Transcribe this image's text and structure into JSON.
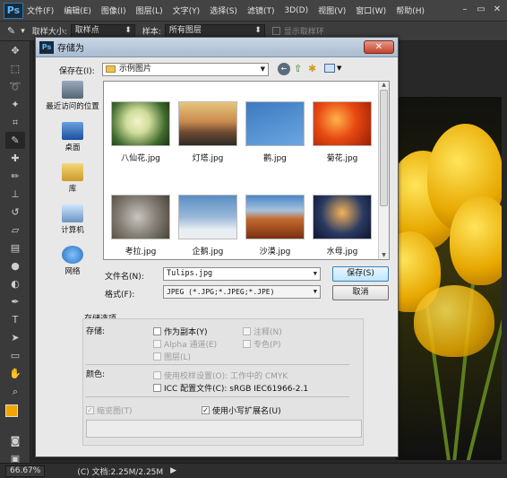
{
  "app": {
    "logo": "Ps",
    "menu": [
      "文件(F)",
      "编辑(E)",
      "图像(I)",
      "图层(L)",
      "文字(Y)",
      "选择(S)",
      "滤镜(T)",
      "3D(D)",
      "视图(V)",
      "窗口(W)",
      "帮助(H)"
    ]
  },
  "options": {
    "sample_size_label": "取样大小:",
    "sample_size_value": "取样点",
    "sample_label": "样本:",
    "sample_value": "所有图层",
    "show_ring_label": "显示取样环"
  },
  "status": {
    "zoom": "66.67%",
    "doc": "(C) 文档:2.25M/2.25M"
  },
  "dialog": {
    "title": "存储为",
    "save_in_label": "保存在(I):",
    "save_in_value": "示例图片",
    "places": [
      "最近访问的位置",
      "桌面",
      "库",
      "计算机",
      "网络"
    ],
    "files": [
      {
        "name": "八仙花.jpg"
      },
      {
        "name": "灯塔.jpg"
      },
      {
        "name": "鹳.jpg"
      },
      {
        "name": "菊花.jpg"
      },
      {
        "name": "考拉.jpg"
      },
      {
        "name": "企鹅.jpg"
      },
      {
        "name": "沙漠.jpg"
      },
      {
        "name": "水母.jpg"
      }
    ],
    "filename_label": "文件名(N):",
    "filename_value": "Tulips.jpg",
    "format_label": "格式(F):",
    "format_value": "JPEG (*.JPG;*.JPEG;*.JPE)",
    "save_button": "保存(S)",
    "cancel_button": "取消",
    "save_options_title": "存储选项",
    "save_label": "存储:",
    "as_copy": "作为副本(Y)",
    "notes": "注释(N)",
    "alpha": "Alpha 通道(E)",
    "spot": "专色(P)",
    "layers": "图层(L)",
    "color_label": "颜色:",
    "use_proof": "使用校样设置(O): 工作中的 CMYK",
    "icc": "ICC 配置文件(C): sRGB IEC61966-2.1",
    "thumbnail": "缩览图(T)",
    "lowercase_ext": "使用小写扩展名(U)"
  }
}
